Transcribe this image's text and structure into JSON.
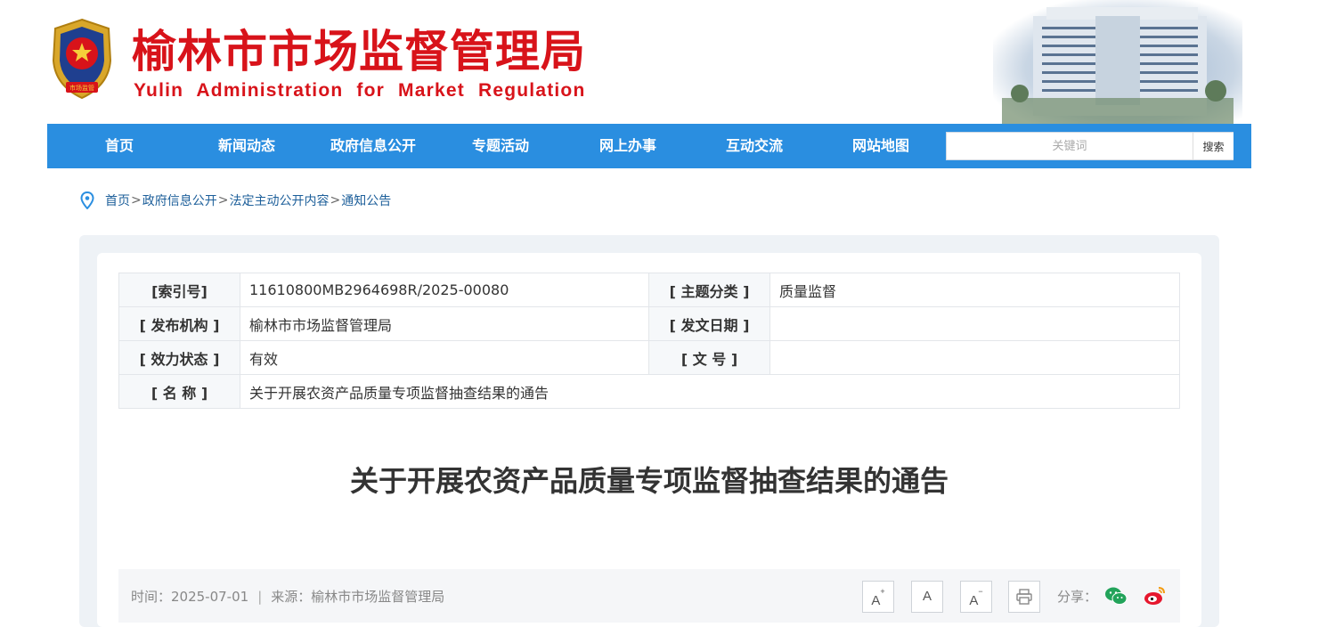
{
  "header": {
    "title_cn": "榆林市市场监督管理局",
    "title_en": "Yulin Administration for Market Regulation",
    "emblem_text": "市场监管",
    "brand_color": "#d8131a"
  },
  "nav": {
    "bg_color": "#2a8ee0",
    "items": [
      {
        "label": "首页"
      },
      {
        "label": "新闻动态"
      },
      {
        "label": "政府信息公开"
      },
      {
        "label": "专题活动"
      },
      {
        "label": "网上办事"
      },
      {
        "label": "互动交流"
      },
      {
        "label": "网站地图"
      }
    ],
    "search": {
      "placeholder": "关键词",
      "button_label": "搜索"
    }
  },
  "breadcrumb": {
    "icon": "location-pin-icon",
    "items": [
      "首页",
      "政府信息公开",
      "法定主动公开内容",
      "通知公告"
    ],
    "separator": ">"
  },
  "meta": {
    "index_label": "[索引号]",
    "index_value": "11610800MB2964698R/2025-00080",
    "topic_label": "[ 主题分类 ]",
    "topic_value": "质量监督",
    "publisher_label": "[ 发布机构 ]",
    "publisher_value": "榆林市市场监督管理局",
    "date_label": "[ 发文日期 ]",
    "date_value": "",
    "status_label": "[ 效力状态 ]",
    "status_value": "有效",
    "docno_label": "[ 文 号 ]",
    "docno_value": "",
    "name_label": "[ 名 称 ]",
    "name_value": "关于开展农资产品质量专项监督抽查结果的通告"
  },
  "article": {
    "title": "关于开展农资产品质量专项监督抽查结果的通告",
    "time": "时间：2025-07-01",
    "source": "来源：榆林市市场监督管理局"
  },
  "tools": {
    "font_larger": "A",
    "font_normal": "A",
    "font_smaller": "A",
    "larger_sup": "+",
    "smaller_sup": "−",
    "share_label": "分享：",
    "icons": [
      "print-icon",
      "wechat-icon",
      "weibo-icon"
    ]
  }
}
